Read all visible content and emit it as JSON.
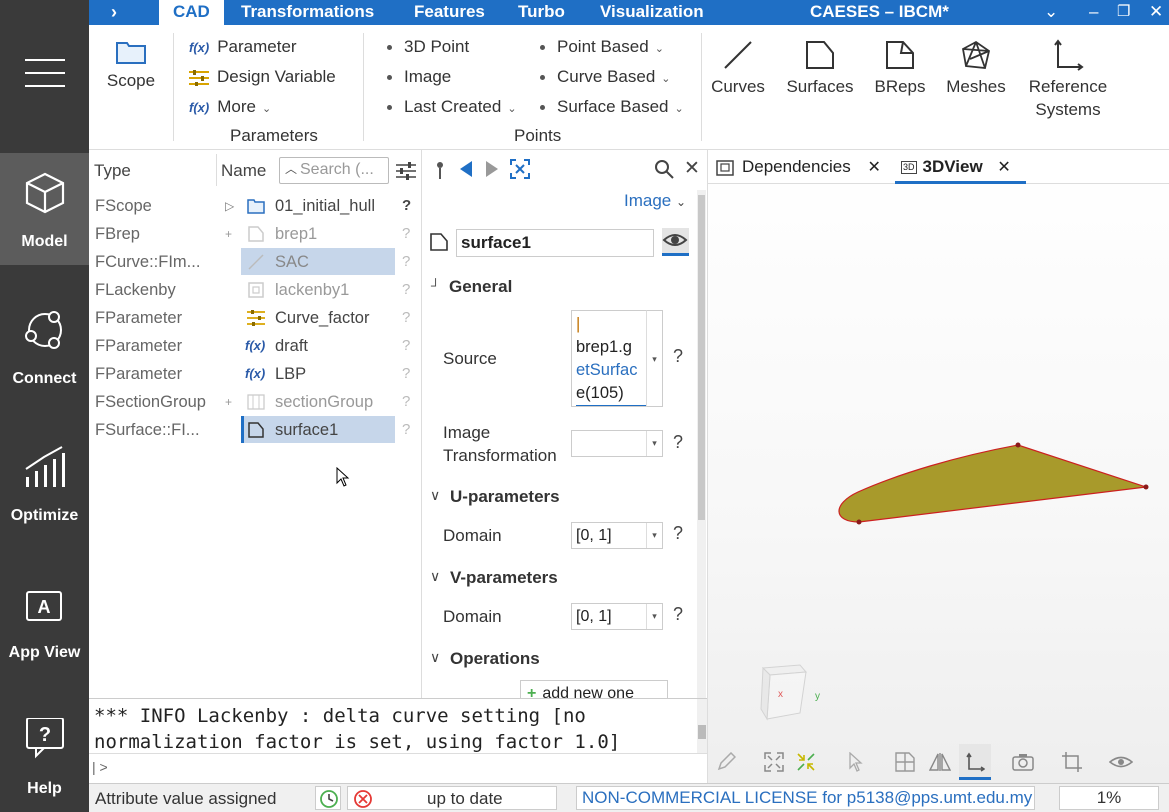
{
  "titlebar": {
    "expand_icon": "chevron-right",
    "tabs": [
      "CAD",
      "Transformations",
      "Features",
      "Turbo",
      "Visualization"
    ],
    "app_title": "CAESES – IBCM*"
  },
  "rail": [
    {
      "label": "Model",
      "icon": "cube-icon",
      "active": true
    },
    {
      "label": "Connect",
      "icon": "connect-icon"
    },
    {
      "label": "Optimize",
      "icon": "chart-icon"
    },
    {
      "label": "App View",
      "icon": "appview-icon"
    },
    {
      "label": "Help",
      "icon": "help-icon"
    }
  ],
  "ribbon": {
    "scope": "Scope",
    "parameters": {
      "parameter": "Parameter",
      "design_variable": "Design Variable",
      "more": "More",
      "group": "Parameters"
    },
    "points": {
      "col1": [
        "3D Point",
        "Image",
        "Last Created"
      ],
      "col2": [
        "Point Based",
        "Curve Based",
        "Surface Based"
      ],
      "group": "Points"
    },
    "big": {
      "curves": "Curves",
      "surfaces": "Surfaces",
      "breps": "BReps",
      "meshes": "Meshes",
      "ref1": "Reference",
      "ref2": "Systems"
    },
    "fx": "f(x)"
  },
  "tree": {
    "col_type": "Type",
    "col_name": "Name",
    "search_placeholder": "Search (...",
    "rows": [
      {
        "type": "FScope",
        "name": "01_initial_hull",
        "q": "?",
        "expand": "▷"
      },
      {
        "type": "FBrep",
        "name": "brep1",
        "q": "?",
        "expand": "+"
      },
      {
        "type": "FCurve::FIm...",
        "name": "SAC",
        "q": "?",
        "expand": ""
      },
      {
        "type": "FLackenby",
        "name": "lackenby1",
        "q": "?",
        "expand": ""
      },
      {
        "type": "FParameter",
        "name": "Curve_factor",
        "q": "?",
        "expand": ""
      },
      {
        "type": "FParameter",
        "name": "draft",
        "q": "?",
        "expand": ""
      },
      {
        "type": "FParameter",
        "name": "LBP",
        "q": "?",
        "expand": ""
      },
      {
        "type": "FSectionGroup",
        "name": "sectionGroup",
        "q": "?",
        "expand": "+"
      },
      {
        "type": "FSurface::FI...",
        "name": "surface1",
        "q": "?",
        "expand": ""
      }
    ]
  },
  "props": {
    "image_dropdown": "Image",
    "object_name": "surface1",
    "general": "General",
    "source_label": "Source",
    "source_lines": [
      "|",
      "brep1.g",
      "etSurfac",
      "e(105)"
    ],
    "image_label1": "Image",
    "image_label2": "Transformation",
    "u_params": "U-parameters",
    "v_params": "V-parameters",
    "domain_label": "Domain",
    "u_domain": "[0, 1]",
    "v_domain": "[0, 1]",
    "operations": "Operations",
    "add_new": "add new one",
    "q": "?"
  },
  "view": {
    "tab_dependencies": "Dependencies",
    "tab_3dview": "3DView",
    "tab_3d_badge": "3D",
    "surface_color": "#a89a2b",
    "edge_color": "#cc2020",
    "cube_x": "x",
    "cube_y": "y"
  },
  "console": {
    "line1": "*** INFO Lackenby : delta curve setting [no",
    "line2": "normalization factor is set, using factor 1.0]",
    "prompt": "| >"
  },
  "status": {
    "message": "Attribute value assigned",
    "state": "up to date",
    "license": "NON-COMMERCIAL LICENSE for p5138@pps.umt.edu.my",
    "zoom": "1%"
  },
  "colors": {
    "accent": "#1f6fc5",
    "rail": "#3a3a3a",
    "selection": "#c6d6ea"
  }
}
